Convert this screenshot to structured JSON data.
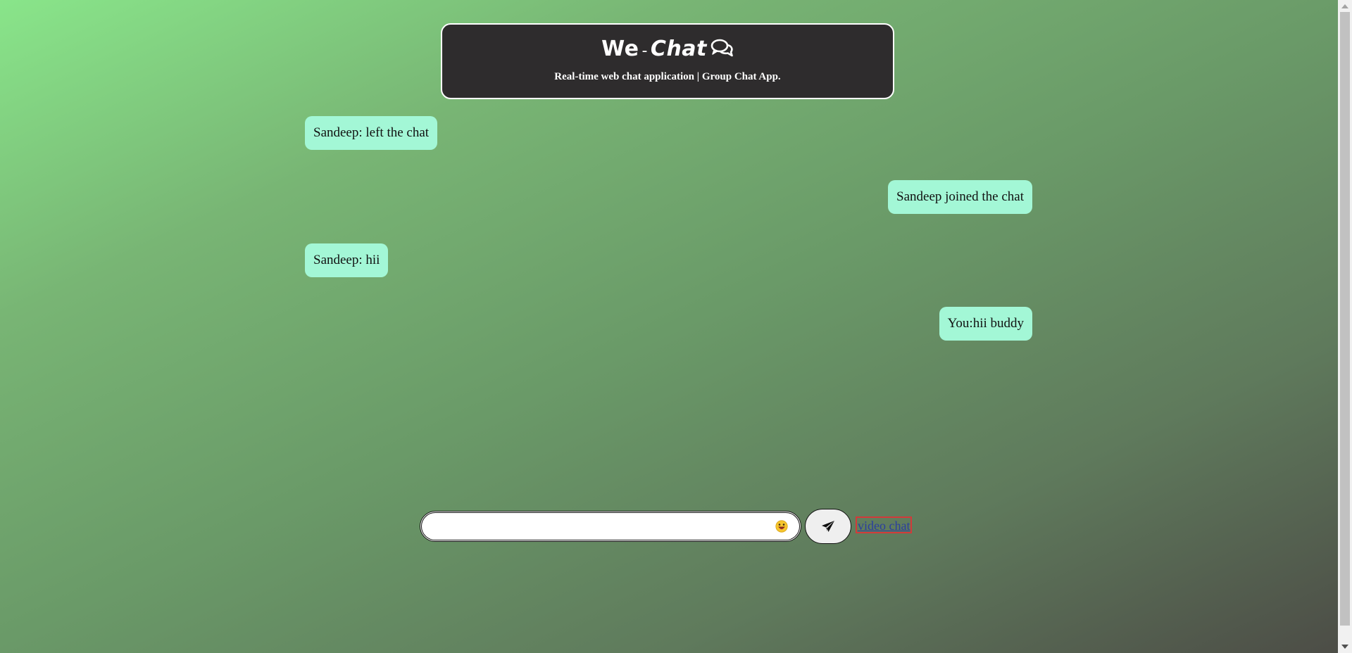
{
  "header": {
    "title_part1": "We",
    "title_dash": "-",
    "title_part2": "Chat",
    "title_icon": "chat-bubbles-icon",
    "subtitle": "Real-time web chat application | Group Chat App."
  },
  "messages": [
    {
      "text": "Sandeep: left the chat",
      "side": "left"
    },
    {
      "text": "Sandeep joined the chat",
      "side": "right"
    },
    {
      "text": "Sandeep: hii",
      "side": "left"
    },
    {
      "text": "You:hii buddy",
      "side": "right"
    }
  ],
  "composer": {
    "placeholder": "",
    "value": "",
    "emoji_icon": "smiley-emoji-icon",
    "send_icon": "paper-plane-icon",
    "video_link_label": "video chat"
  },
  "colors": {
    "header_bg": "#2e2c2d",
    "bubble_bg": "#a3f7d6",
    "link": "#2a3ea0",
    "link_outline": "#d23a3a",
    "gradient_start": "#89e58a",
    "gradient_end": "#4c4c46"
  }
}
